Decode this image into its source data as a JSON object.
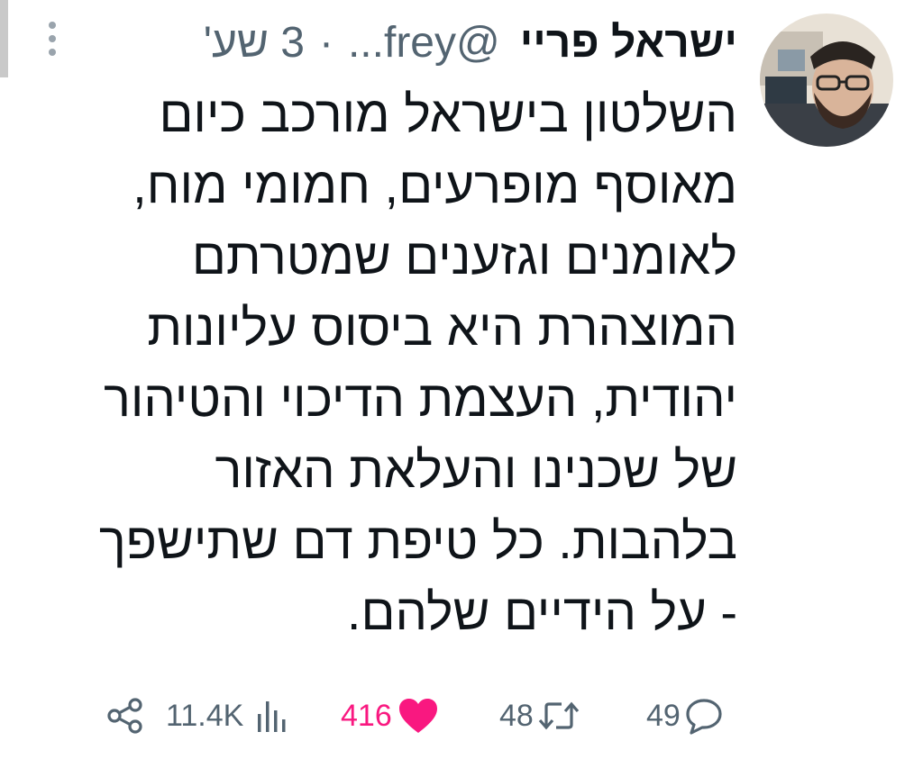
{
  "tweet": {
    "author_name": "ישראל פריי",
    "handle": "@frey...",
    "separator": "·",
    "time": "3 שע'",
    "text_lines": [
      "השלטון בישראל מורכב כיום",
      "מאוסף מופרעים, חמומי מוח,",
      "לאומנים וגזענים שמטרתם",
      "המוצהרת היא ביסוס עליונות",
      "יהודית, העצמת הדיכוי והטיהור",
      "של שכנינו והעלאת האזור",
      "בלהבות. כל טיפת דם שתישפך",
      "- על הידיים שלהם."
    ]
  },
  "actions": {
    "replies": "49",
    "retweets": "48",
    "likes": "416",
    "views": "11.4K"
  },
  "colors": {
    "text": "#0f1419",
    "muted": "#536471",
    "like": "#f91880"
  },
  "icons": {
    "more": "more-vertical-icon",
    "reply": "reply-icon",
    "retweet": "retweet-icon",
    "like": "heart-icon",
    "views": "views-icon",
    "share": "share-icon"
  }
}
